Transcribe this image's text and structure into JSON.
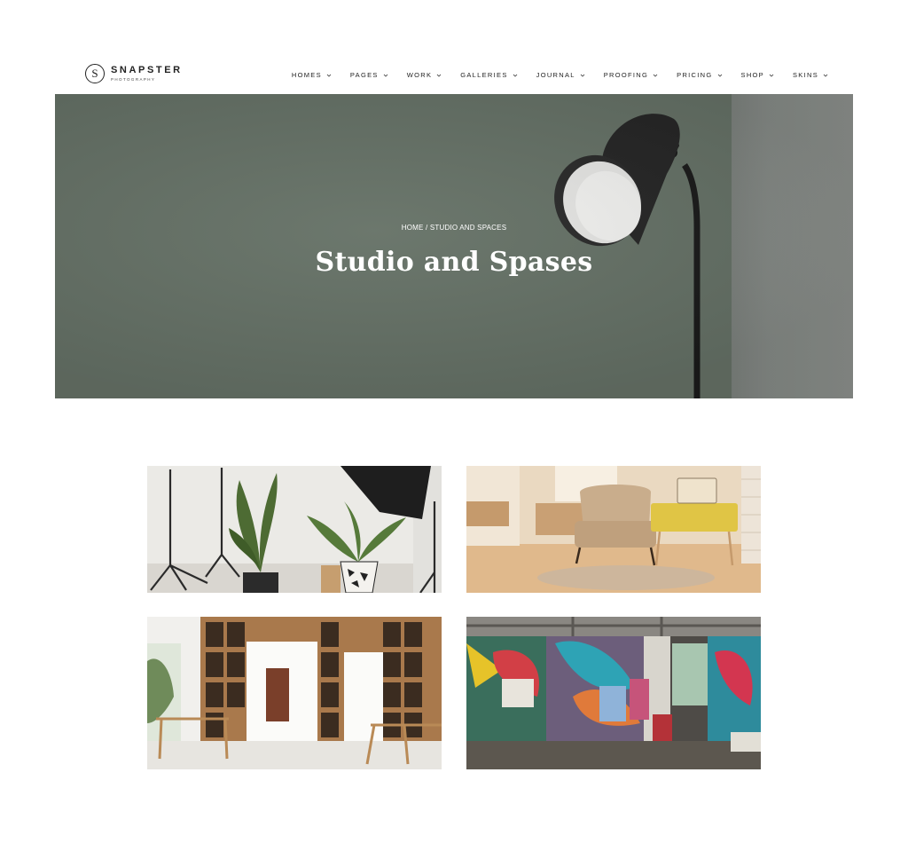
{
  "brand": {
    "mark": "S",
    "name": "SNAPSTER",
    "tagline": "PHOTOGRAPHY"
  },
  "nav": {
    "items": [
      {
        "label": "HOMES"
      },
      {
        "label": "PAGES"
      },
      {
        "label": "WORK"
      },
      {
        "label": "GALLERIES"
      },
      {
        "label": "JOURNAL"
      },
      {
        "label": "PROOFING"
      },
      {
        "label": "PRICING"
      },
      {
        "label": "SHOP"
      },
      {
        "label": "SKINS"
      }
    ]
  },
  "hero": {
    "breadcrumb_home": "HOME",
    "breadcrumb_separator": " / ",
    "breadcrumb_current": "STUDIO AND SPACES",
    "title": "Studio and Spases",
    "background_color": "#667267"
  },
  "gallery": {
    "images": [
      {
        "subject": "photo studio with tripods, softbox and plants"
      },
      {
        "subject": "room with armchair, yellow suitcase table and radio"
      },
      {
        "subject": "white room with wooden shelving and tables"
      },
      {
        "subject": "industrial loft with graffiti walls and easels"
      }
    ]
  }
}
